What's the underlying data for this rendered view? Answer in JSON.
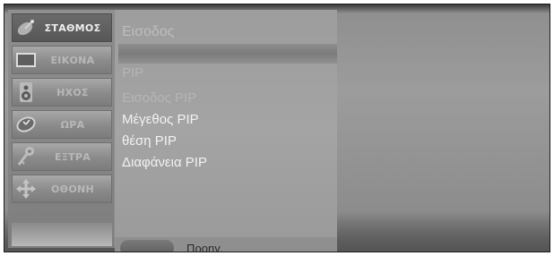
{
  "sidebar": {
    "items": [
      {
        "label": "ΣΤΑΘΜΟΣ",
        "icon": "satellite-dish-icon"
      },
      {
        "label": "ΕΙΚΟΝΑ",
        "icon": "picture-screen-icon"
      },
      {
        "label": "ΗΧΟΣ",
        "icon": "speaker-icon"
      },
      {
        "label": "ΩΡΑ",
        "icon": "clock-icon"
      },
      {
        "label": "ΕΞΤΡΑ",
        "icon": "key-icon"
      },
      {
        "label": "ΟΘΟΝΗ",
        "icon": "screen-move-icon"
      }
    ],
    "active_index": 0
  },
  "panel": {
    "title": "Εισοδος",
    "items": [
      {
        "label": "PIP",
        "dim": true
      },
      {
        "label": "Εισοδος PIP",
        "dim": true
      },
      {
        "label": "Μέγεθος PIP",
        "dim": false
      },
      {
        "label": "θέση PIP",
        "dim": false
      },
      {
        "label": "Διαφάνεια PIP",
        "dim": false
      }
    ],
    "footer": {
      "prev_label": "Προηγ."
    }
  },
  "colors": {
    "background": "#9a9a9a",
    "menu_text": "#f2f2f2",
    "dim_text": "#b5b5b5"
  }
}
